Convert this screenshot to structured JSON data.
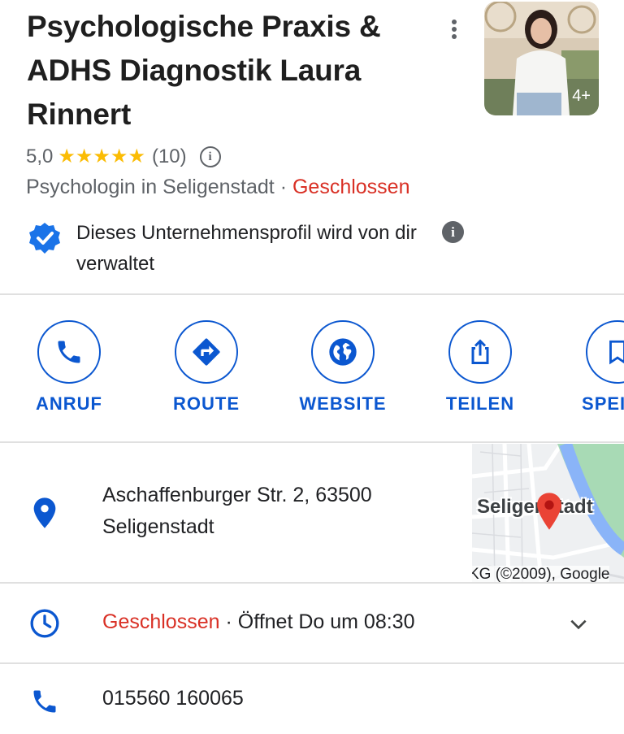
{
  "business": {
    "name": "Psychologische Praxis & ADHS Diagnostik Laura Rinnert",
    "photo_count": "4+",
    "rating": "5,0",
    "review_count": "(10)",
    "star_count": 5,
    "category": "Psychologin in Seligenstadt",
    "separator": " · ",
    "status": "Geschlossen",
    "verified_text": "Dieses Unternehmensprofil wird von dir verwaltet"
  },
  "actions": [
    {
      "label": "ANRUF",
      "icon": "phone-icon"
    },
    {
      "label": "ROUTE",
      "icon": "directions-icon"
    },
    {
      "label": "WEBSITE",
      "icon": "globe-icon"
    },
    {
      "label": "TEILEN",
      "icon": "share-icon"
    },
    {
      "label": "SPEICH",
      "icon": "bookmark-icon"
    }
  ],
  "details": {
    "address": "Aschaffenburger Str. 2, 63500 Seligenstadt",
    "map_label": "Seligenstadt",
    "map_attribution": "KG (©2009), Google",
    "hours_status": "Geschlossen",
    "hours_separator": " · ",
    "hours_next": "Öffnet Do um 08:30",
    "phone": "015560 160065"
  },
  "colors": {
    "accent": "#0b57d0",
    "star": "#fbbc04",
    "closed": "#d93025",
    "map_pin": "#ea4335"
  }
}
